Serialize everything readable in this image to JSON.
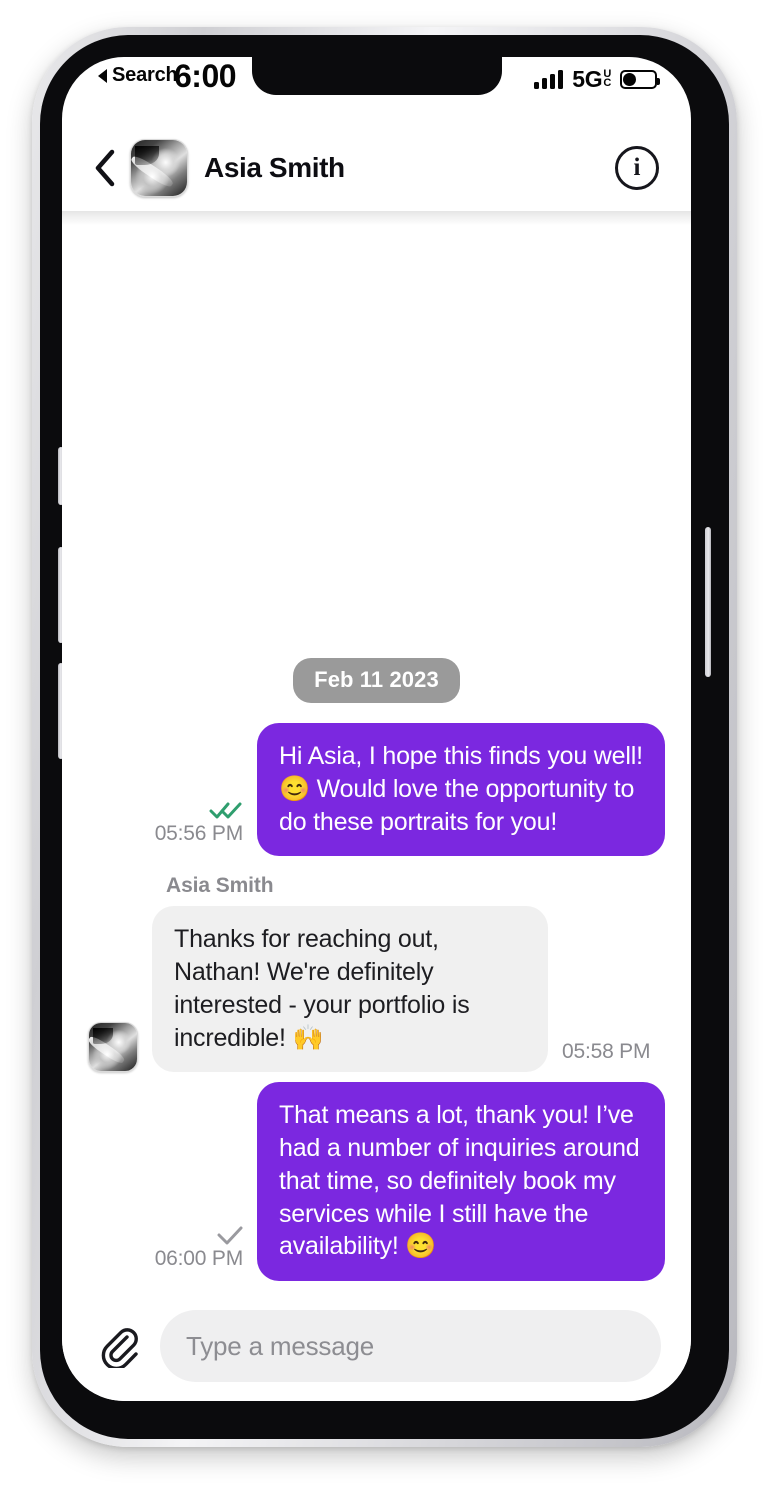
{
  "status_bar": {
    "time": "6:00",
    "back_app_label": "Search",
    "back_arrow_icon": "triangle-left-icon",
    "signal_icon": "cellular-bars-icon",
    "signal_bars": 4,
    "network": "5G",
    "network_sub_top": "U",
    "network_sub_bottom": "C",
    "battery_icon": "battery-icon"
  },
  "header": {
    "back_icon": "chevron-left-icon",
    "avatar_icon": "contact-avatar-photo",
    "contact_name": "Asia Smith",
    "info_icon": "info-circle-icon",
    "info_glyph": "i"
  },
  "conversation": {
    "date_divider": "Feb 11 2023",
    "messages": [
      {
        "id": "msg-1",
        "direction": "outgoing",
        "text": "Hi Asia, I hope this finds you well! 😊  Would love the opportunity to do these portraits for you!",
        "timestamp": "05:56 PM",
        "status": "read",
        "status_icon": "double-check-icon"
      },
      {
        "id": "msg-2",
        "direction": "incoming",
        "sender": "Asia Smith",
        "text": "Thanks for reaching out, Nathan! We're definitely interested - your portfolio is incredible! 🙌",
        "timestamp": "05:58 PM",
        "avatar_icon": "contact-avatar-photo"
      },
      {
        "id": "msg-3",
        "direction": "outgoing",
        "text": "That means a lot, thank you! I’ve had a number of inquiries around that time, so definitely book my services while I still have the availability! 😊",
        "timestamp": "06:00 PM",
        "status": "delivered",
        "status_icon": "single-check-icon"
      }
    ]
  },
  "composer": {
    "attach_icon": "paperclip-icon",
    "input_value": "",
    "input_placeholder": "Type a message"
  },
  "colors": {
    "outgoing_bubble": "#7B28E0",
    "incoming_bubble": "#f0f0f0",
    "date_chip": "#9a9a9a",
    "read_tick": "#2f9e6e",
    "delivered_tick": "#9a9a9f",
    "muted_text": "#8a8a8f"
  }
}
